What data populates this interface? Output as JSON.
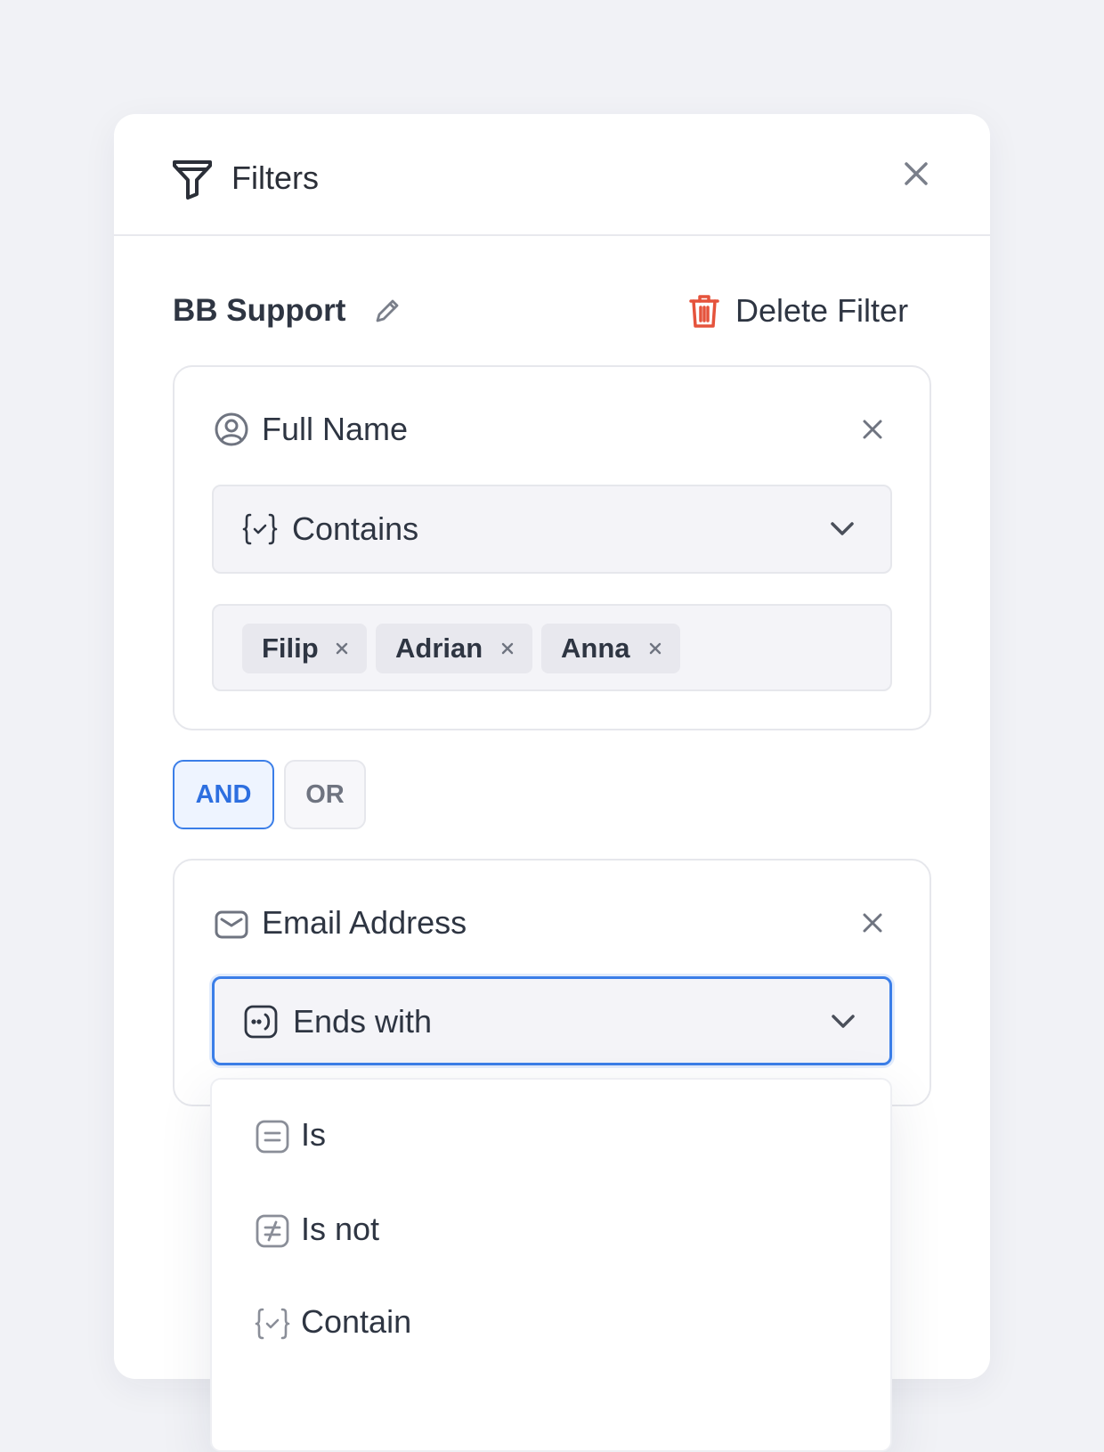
{
  "panel": {
    "title": "Filters",
    "filter_name": "BB Support",
    "delete_label": "Delete Filter"
  },
  "rule1": {
    "field": "Full Name",
    "operator": "Contains",
    "tags": [
      "Filip",
      "Adrian",
      "Anna"
    ]
  },
  "logic": {
    "and_label": "AND",
    "or_label": "OR",
    "selected": "AND"
  },
  "rule2": {
    "field": "Email Address",
    "operator": "Ends with"
  },
  "dropdown": {
    "options": [
      "Is",
      "Is not",
      "Contain"
    ]
  },
  "colors": {
    "accent": "#3b7ee8",
    "danger": "#e5533c",
    "background": "#f1f2f6"
  }
}
